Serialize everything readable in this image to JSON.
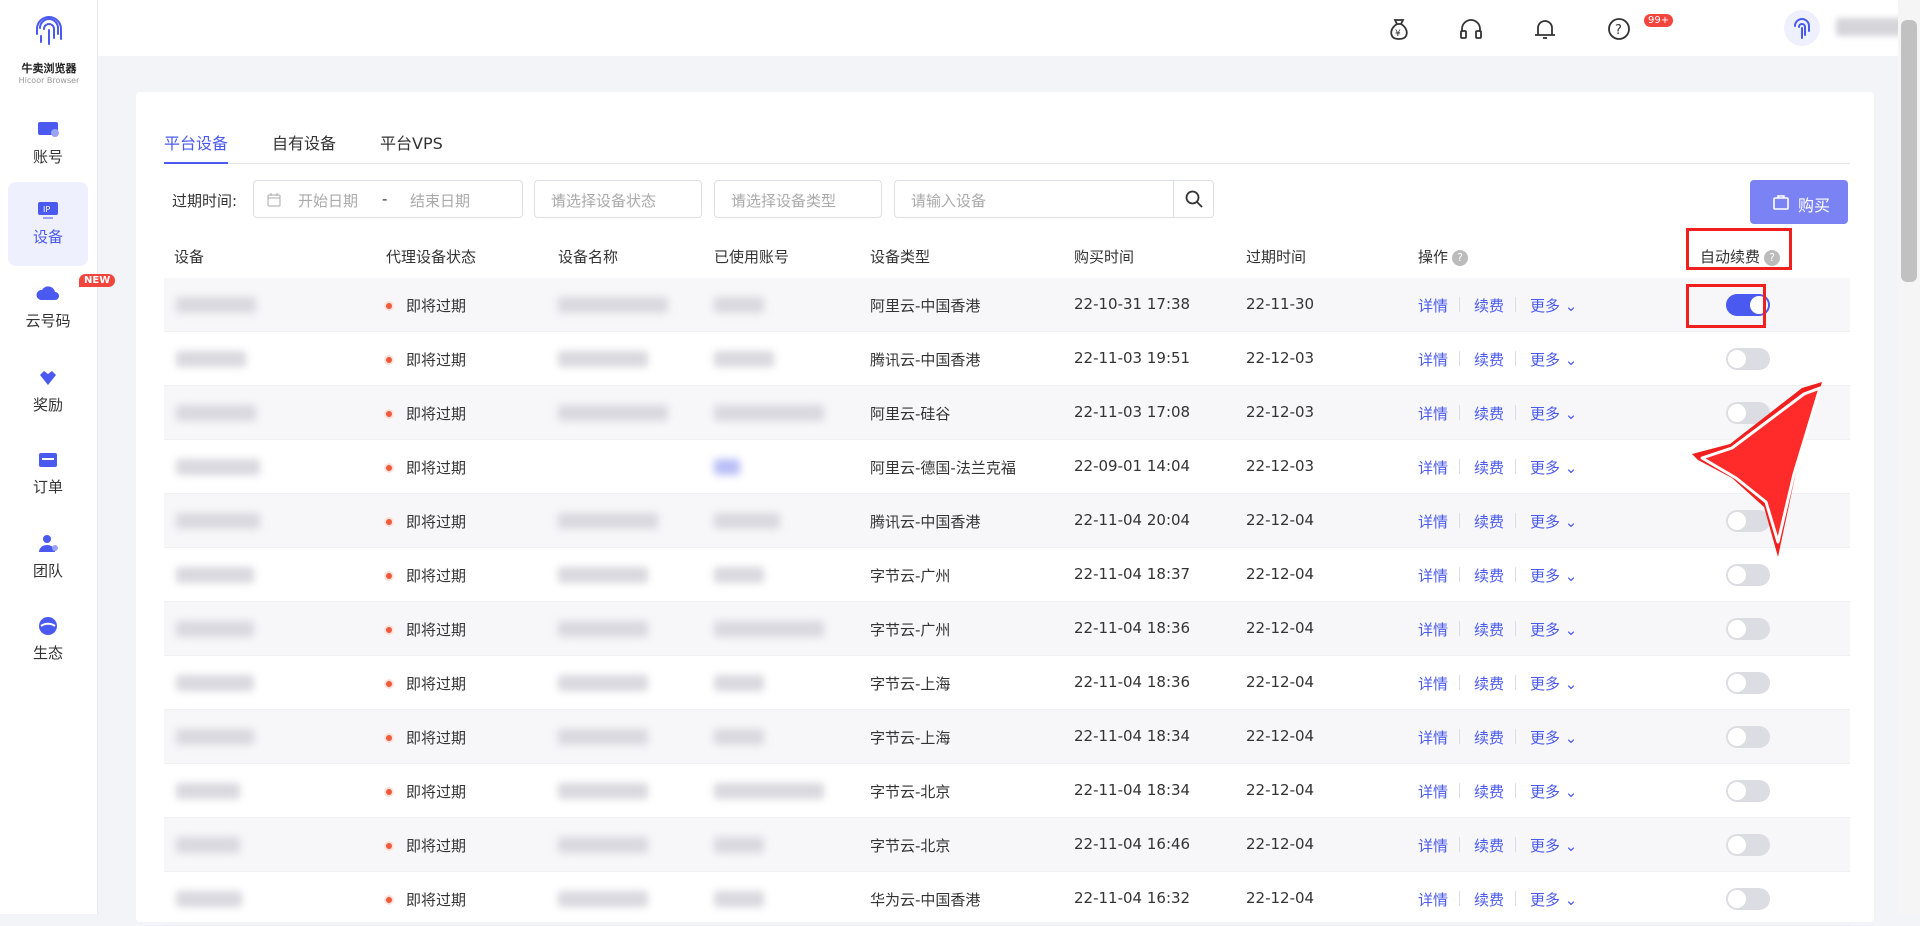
{
  "app": {
    "name": "牛卖浏览器",
    "subtitle": "Hicoor Browser"
  },
  "sidebar": {
    "items": [
      {
        "label": "账号",
        "icon": "monitor-icon"
      },
      {
        "label": "设备",
        "icon": "ip-device-icon",
        "active": true
      },
      {
        "label": "云号码",
        "icon": "cloud-icon",
        "badge": "NEW"
      },
      {
        "label": "奖励",
        "icon": "reward-icon"
      },
      {
        "label": "订单",
        "icon": "order-icon"
      },
      {
        "label": "团队",
        "icon": "team-icon"
      },
      {
        "label": "生态",
        "icon": "ecosystem-icon"
      }
    ]
  },
  "header": {
    "notification_badge": "99+"
  },
  "tabs": [
    "平台设备",
    "自有设备",
    "平台VPS"
  ],
  "filters": {
    "expire_label": "过期时间:",
    "start_placeholder": "开始日期",
    "range_sep": "-",
    "end_placeholder": "结束日期",
    "status_placeholder": "请选择设备状态",
    "type_placeholder": "请选择设备类型",
    "search_placeholder": "请输入设备",
    "buy_label": "购买"
  },
  "table": {
    "columns": [
      "设备",
      "代理设备状态",
      "设备名称",
      "已使用账号",
      "设备类型",
      "购买时间",
      "过期时间",
      "操作",
      "自动续费"
    ],
    "actions": {
      "detail": "详情",
      "renew": "续费",
      "more": "更多"
    },
    "rows": [
      {
        "status": "即将过期",
        "type": "阿里云-中国香港",
        "purchased": "22-10-31 17:38",
        "expires": "22-11-30",
        "auto_renew": true
      },
      {
        "status": "即将过期",
        "type": "腾讯云-中国香港",
        "purchased": "22-11-03 19:51",
        "expires": "22-12-03",
        "auto_renew": false
      },
      {
        "status": "即将过期",
        "type": "阿里云-硅谷",
        "purchased": "22-11-03 17:08",
        "expires": "22-12-03",
        "auto_renew": false
      },
      {
        "status": "即将过期",
        "type": "阿里云-德国-法兰克福",
        "purchased": "22-09-01 14:04",
        "expires": "22-12-03",
        "auto_renew": false
      },
      {
        "status": "即将过期",
        "type": "腾讯云-中国香港",
        "purchased": "22-11-04 20:04",
        "expires": "22-12-04",
        "auto_renew": false
      },
      {
        "status": "即将过期",
        "type": "字节云-广州",
        "purchased": "22-11-04 18:37",
        "expires": "22-12-04",
        "auto_renew": false
      },
      {
        "status": "即将过期",
        "type": "字节云-广州",
        "purchased": "22-11-04 18:36",
        "expires": "22-12-04",
        "auto_renew": false
      },
      {
        "status": "即将过期",
        "type": "字节云-上海",
        "purchased": "22-11-04 18:36",
        "expires": "22-12-04",
        "auto_renew": false
      },
      {
        "status": "即将过期",
        "type": "字节云-上海",
        "purchased": "22-11-04 18:34",
        "expires": "22-12-04",
        "auto_renew": false
      },
      {
        "status": "即将过期",
        "type": "字节云-北京",
        "purchased": "22-11-04 18:34",
        "expires": "22-12-04",
        "auto_renew": false
      },
      {
        "status": "即将过期",
        "type": "字节云-北京",
        "purchased": "22-11-04 16:46",
        "expires": "22-12-04",
        "auto_renew": false
      },
      {
        "status": "即将过期",
        "type": "华为云-中国香港",
        "purchased": "22-11-04 16:32",
        "expires": "22-12-04",
        "auto_renew": false
      }
    ]
  },
  "colors": {
    "accent": "#4a5af0",
    "annotation": "#f21f1f",
    "status_dot": "#ee5a3a"
  }
}
